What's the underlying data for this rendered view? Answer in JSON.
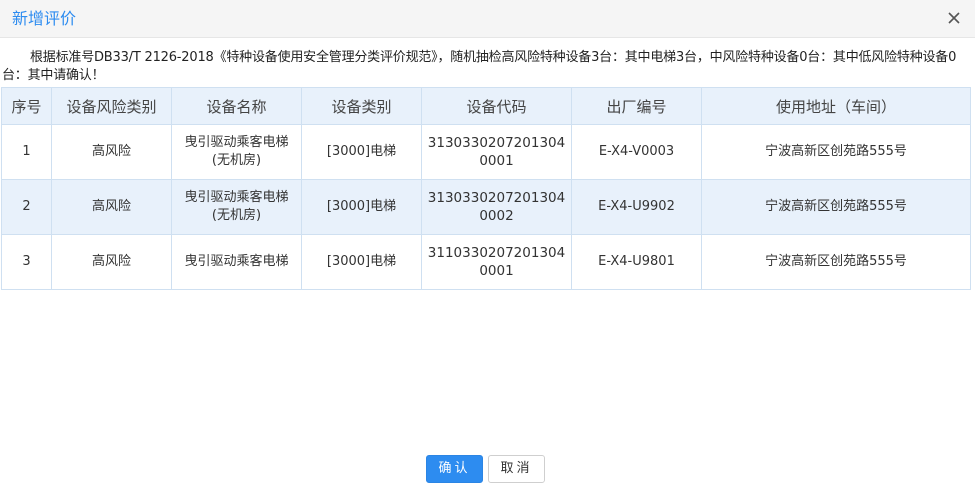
{
  "dialog": {
    "title": "新增评价",
    "notice": "根据标准号DB33/T 2126-2018《特种设备使用安全管理分类评价规范》，随机抽检高风险特种设备3台：其中电梯3台，中风险特种设备0台：其中低风险特种设备0台：其中请确认！",
    "close_icon": "close-icon"
  },
  "table": {
    "headers": [
      "序号",
      "设备风险类别",
      "设备名称",
      "设备类别",
      "设备代码",
      "出厂编号",
      "使用地址（车间）"
    ],
    "rows": [
      {
        "index": "1",
        "risk": "高风险",
        "name": "曳引驱动乘客电梯(无机房)",
        "type": "[3000]电梯",
        "code": "31303302072013040001",
        "factory_no": "E-X4-V0003",
        "address": "宁波高新区创苑路555号"
      },
      {
        "index": "2",
        "risk": "高风险",
        "name": "曳引驱动乘客电梯(无机房)",
        "type": "[3000]电梯",
        "code": "31303302072013040002",
        "factory_no": "E-X4-U9902",
        "address": "宁波高新区创苑路555号"
      },
      {
        "index": "3",
        "risk": "高风险",
        "name": "曳引驱动乘客电梯",
        "type": "[3000]电梯",
        "code": "31103302072013040001",
        "factory_no": "E-X4-U9801",
        "address": "宁波高新区创苑路555号"
      }
    ]
  },
  "buttons": {
    "confirm_label": "确认",
    "cancel_label": "取消"
  },
  "colors": {
    "accent": "#2d8cf0",
    "header_bg": "#e8f1fb",
    "border": "#cfe0f1"
  }
}
